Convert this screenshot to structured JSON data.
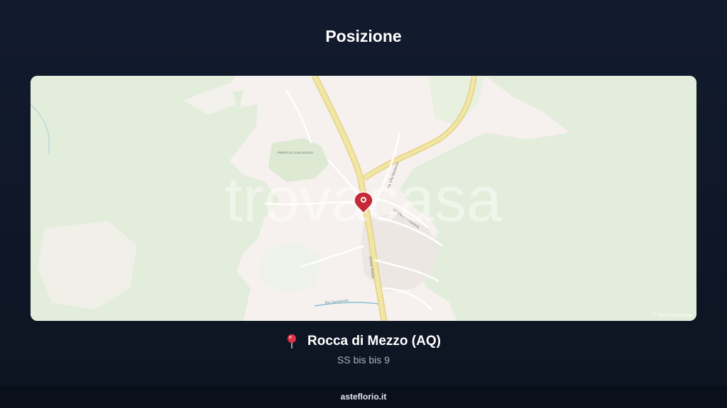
{
  "header": {
    "title": "Posizione"
  },
  "map": {
    "attribution": "© OpenStreetMap",
    "watermark": "trovacasa",
    "labels": {
      "pineta": "PINETA DI SAN LEUCIO",
      "via_madonna": "Via Villa Madonna",
      "sp": "SP Circonvallazione",
      "ss": "Strada Statale",
      "rio": "Rio Gamberale"
    },
    "colors": {
      "land": "#f6f1ee",
      "forest": "#e3eddb",
      "road": "#f2e6a6",
      "road_edge": "#e3d184",
      "marker": "#c62a36",
      "water": "#8bbfd0"
    }
  },
  "location": {
    "pin_icon": "round-pushpin-icon",
    "city": "Rocca di Mezzo (AQ)",
    "address": "SS bis bis 9"
  },
  "footer": {
    "site": "asteflorio.it"
  }
}
